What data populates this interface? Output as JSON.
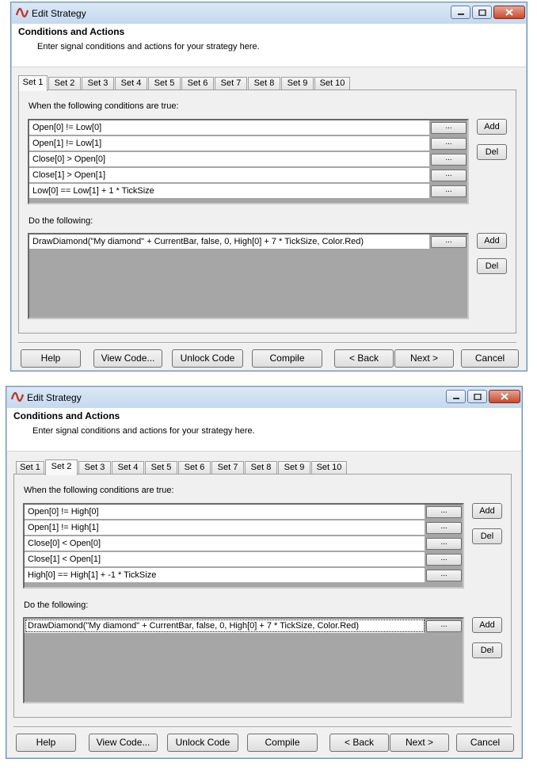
{
  "windows": [
    {
      "title": "Edit Strategy",
      "header_title": "Conditions and Actions",
      "header_description": "Enter signal conditions and actions for your strategy here.",
      "tabs": [
        "Set 1",
        "Set 2",
        "Set 3",
        "Set 4",
        "Set 5",
        "Set 6",
        "Set 7",
        "Set 8",
        "Set 9",
        "Set 10"
      ],
      "active_tab": "Set 1",
      "conditions_label": "When the following conditions are true:",
      "conditions": [
        "Open[0] != Low[0]",
        "Open[1] != Low[1]",
        "Close[0] > Open[0]",
        "Close[1] > Open[1]",
        "Low[0] == Low[1] + 1 * TickSize"
      ],
      "actions_label": "Do the following:",
      "actions": [
        "DrawDiamond(\"My diamond\" + CurrentBar, false, 0, High[0] + 7 * TickSize, Color.Red)"
      ],
      "ellipsis_label": "...",
      "add_label": "Add",
      "del_label": "Del",
      "buttons": {
        "help": "Help",
        "view_code": "View Code...",
        "unlock_code": "Unlock Code",
        "compile": "Compile",
        "back": "< Back",
        "next": "Next >",
        "cancel": "Cancel"
      }
    },
    {
      "title": "Edit Strategy",
      "header_title": "Conditions and Actions",
      "header_description": "Enter signal conditions and actions for your strategy here.",
      "tabs": [
        "Set 1",
        "Set 2",
        "Set 3",
        "Set 4",
        "Set 5",
        "Set 6",
        "Set 7",
        "Set 8",
        "Set 9",
        "Set 10"
      ],
      "active_tab": "Set 2",
      "conditions_label": "When the following conditions are true:",
      "conditions": [
        "Open[0] != High[0]",
        "Open[1] != High[1]",
        "Close[0] < Open[0]",
        "Close[1] < Open[1]",
        "High[0] == High[1] + -1 * TickSize"
      ],
      "actions_label": "Do the following:",
      "actions": [
        "DrawDiamond(\"My diamond\" + CurrentBar, false, 0, High[0] + 7 * TickSize, Color.Red)"
      ],
      "ellipsis_label": "...",
      "add_label": "Add",
      "del_label": "Del",
      "buttons": {
        "help": "Help",
        "view_code": "View Code...",
        "unlock_code": "Unlock Code",
        "compile": "Compile",
        "back": "< Back",
        "next": "Next >",
        "cancel": "Cancel"
      }
    }
  ]
}
